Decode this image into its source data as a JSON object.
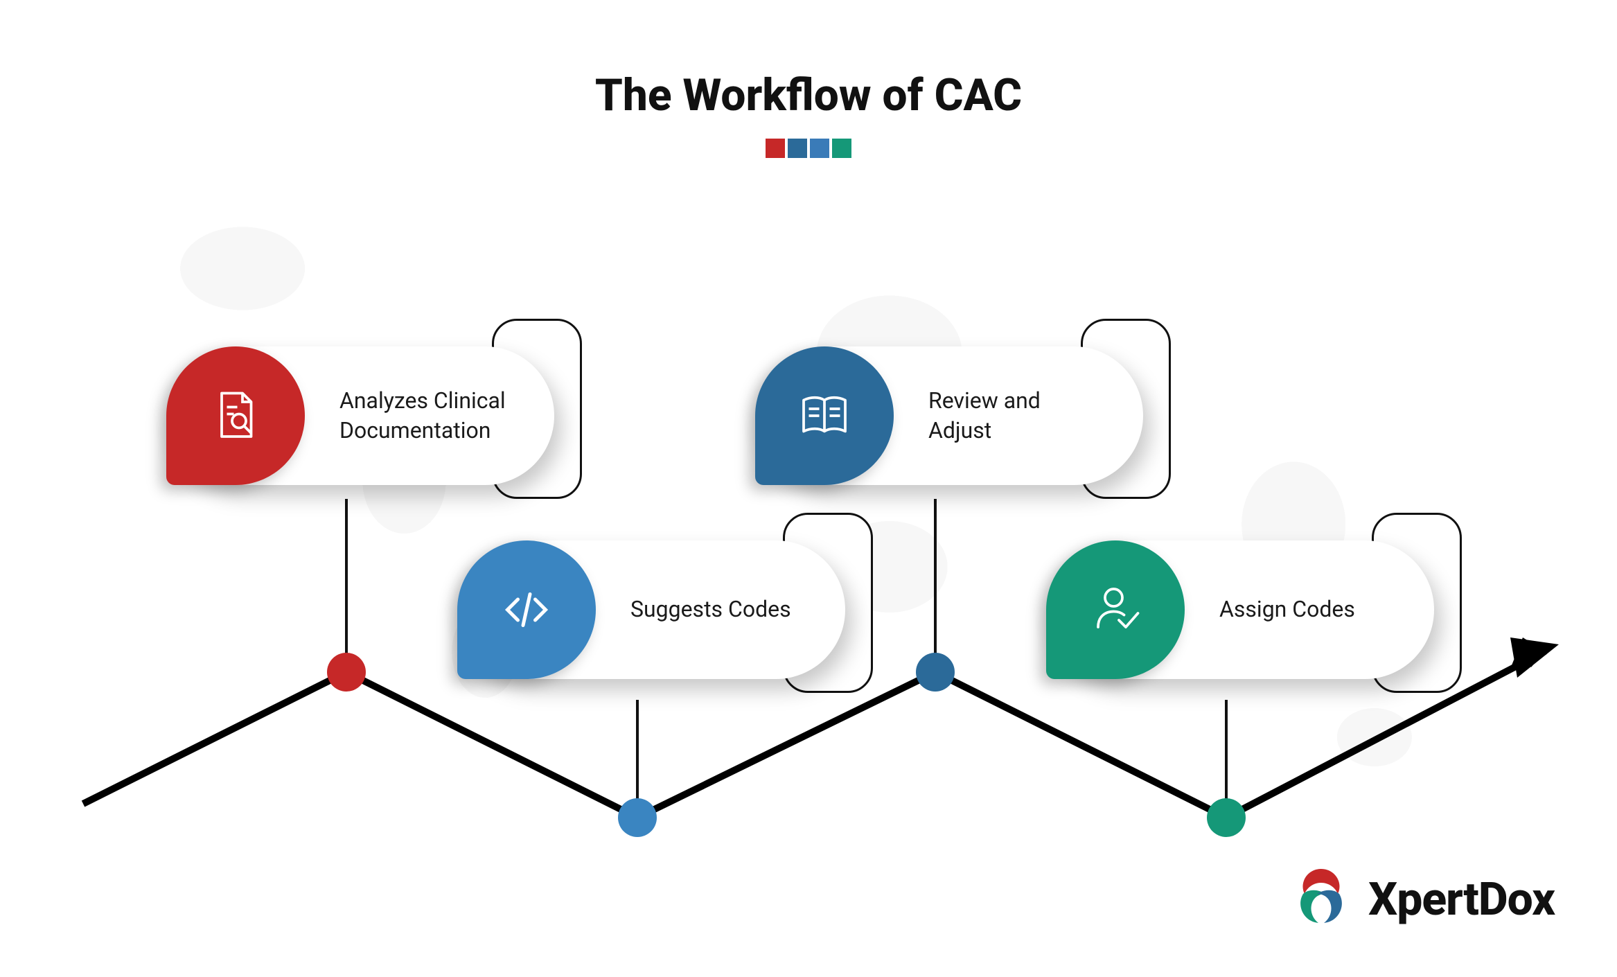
{
  "title": "The Workflow of CAC",
  "colors": {
    "red": "#c62828",
    "blue": "#3a85c1",
    "darkblue": "#2b6a99",
    "teal": "#159878"
  },
  "steps": [
    {
      "label": "Analyzes Clinical\nDocumentation",
      "icon": "document-search",
      "color": "red"
    },
    {
      "label": "Suggests Codes",
      "icon": "code",
      "color": "blue"
    },
    {
      "label": "Review and\nAdjust",
      "icon": "book",
      "color": "darkblue"
    },
    {
      "label": "Assign Codes",
      "icon": "user-check",
      "color": "teal"
    }
  ],
  "logo": "XpertDox"
}
